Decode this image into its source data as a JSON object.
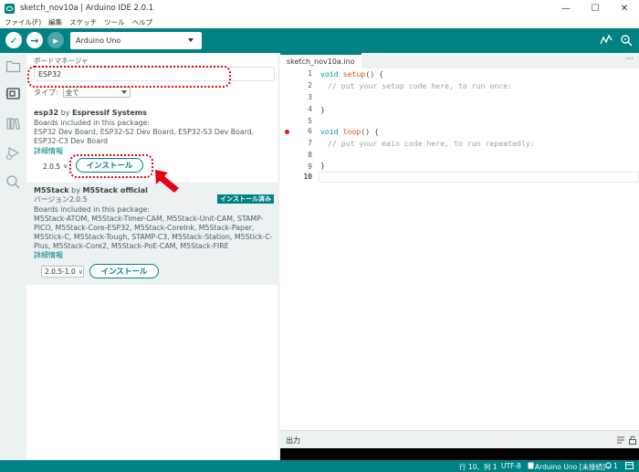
{
  "window": {
    "title": "sketch_nov10a | Arduino IDE 2.0.1",
    "controls": [
      "—",
      "☐",
      "✕"
    ]
  },
  "menu": [
    "ファイル(F)",
    "編集",
    "スケッチ",
    "ツール",
    "ヘルプ"
  ],
  "toolbar": {
    "verify_glyph": "✓",
    "upload_glyph": "→",
    "debug_glyph": "▸",
    "board": "Arduino Uno",
    "serial_plotter_glyph": "⩘",
    "serial_monitor_glyph": "⊙"
  },
  "board_manager": {
    "title": "ボードマネージャ",
    "search_value": "ESP32",
    "type_label": "タイプ:",
    "type_value": "全て",
    "packages": [
      {
        "name": "esp32",
        "by": "by",
        "author": "Espressif Systems",
        "version_label": "",
        "installed_badge": "",
        "description": "Boards included in this package:",
        "boards": "ESP32 Dev Board, ESP32-S2 Dev Board, ESP32-S3 Dev Board, ESP32-C3 Dev Board",
        "more_info": "詳細情報",
        "version": "2.0.5",
        "install_label": "インストール"
      },
      {
        "name": "M5Stack",
        "by": "by",
        "author": "M5Stack official",
        "version_label": "バージョン2.0.5",
        "installed_badge": "インストール済み",
        "description": "Boards included in this package:",
        "boards": "M5Stack-ATOM, M5Stack-Timer-CAM, M5Stack-Unit-CAM, STAMP-PICO, M5Stack-Core-ESP32, M5Stack-CoreInk, M5Stack-Paper, M5Stick-C, M5Stack-Tough, STAMP-C3, M5Stack-Station, M5Stick-C-Plus, M5Stack-Core2, M5Stack-PoE-CAM, M5Stack-FIRE",
        "more_info": "詳細情報",
        "version": "2.0.5-1.0",
        "install_label": "インストール"
      }
    ]
  },
  "editor": {
    "tab": "sketch_nov10a.ino",
    "tab_more": "···",
    "line_numbers": [
      "1",
      "2",
      "3",
      "4",
      "5",
      "6",
      "7",
      "8",
      "9",
      "10"
    ],
    "current_line": 10,
    "breakpoint_line": 6,
    "code": {
      "setup_type": "void",
      "setup_name": "setup",
      "setup_rest": "() {",
      "setup_comment": "// put your setup code here, to run once:",
      "close1": "}",
      "loop_type": "void",
      "loop_name": "loop",
      "loop_rest": "() {",
      "loop_comment": "// put your main code here, to run repeatedly:",
      "close2": "}"
    }
  },
  "output": {
    "title": "出力"
  },
  "status": {
    "position": "行 10、列 1",
    "encoding": "UTF-8",
    "board": "Arduino Uno [未接続]",
    "notifications": "1"
  },
  "colors": {
    "accent": "#008184",
    "annotation": "#e60012"
  }
}
